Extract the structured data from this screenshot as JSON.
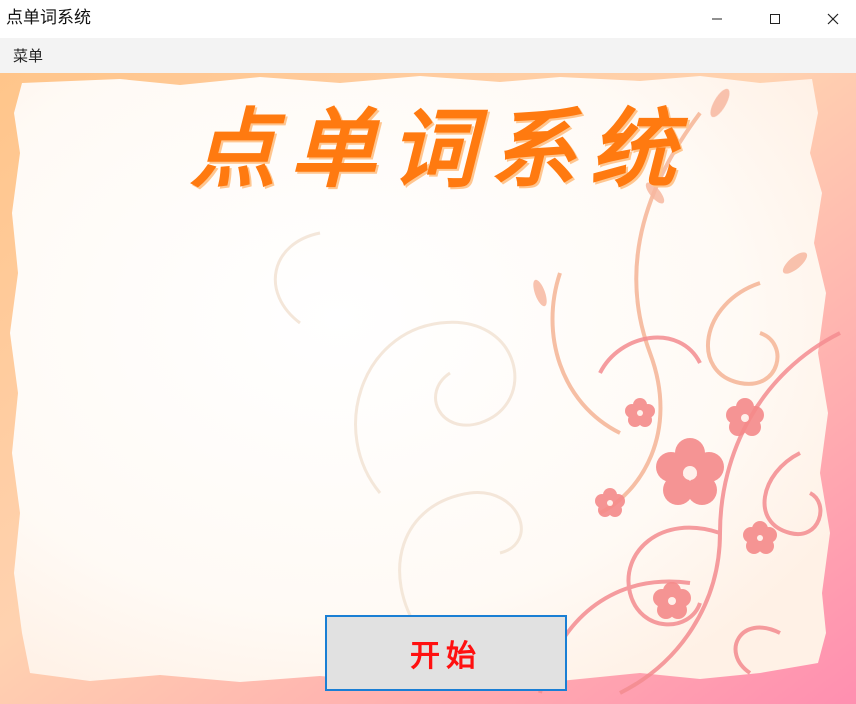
{
  "window": {
    "title": "点单词系统",
    "controls": [
      "minimize-icon",
      "maximize-icon",
      "close-icon"
    ]
  },
  "menubar": {
    "items": [
      {
        "label": "菜单"
      }
    ]
  },
  "main": {
    "heading": "点单词系统",
    "start_button_label": "开始"
  },
  "colors": {
    "heading": "#ff7a10",
    "start_text": "#ff1010",
    "start_border": "#1a7fd4",
    "start_bg": "#e1e1e1",
    "frame_pink": "#ff9bb0",
    "frame_orange": "#ffc58a",
    "flower": "#f58a8a"
  },
  "background": {
    "style": "floral-frame"
  }
}
